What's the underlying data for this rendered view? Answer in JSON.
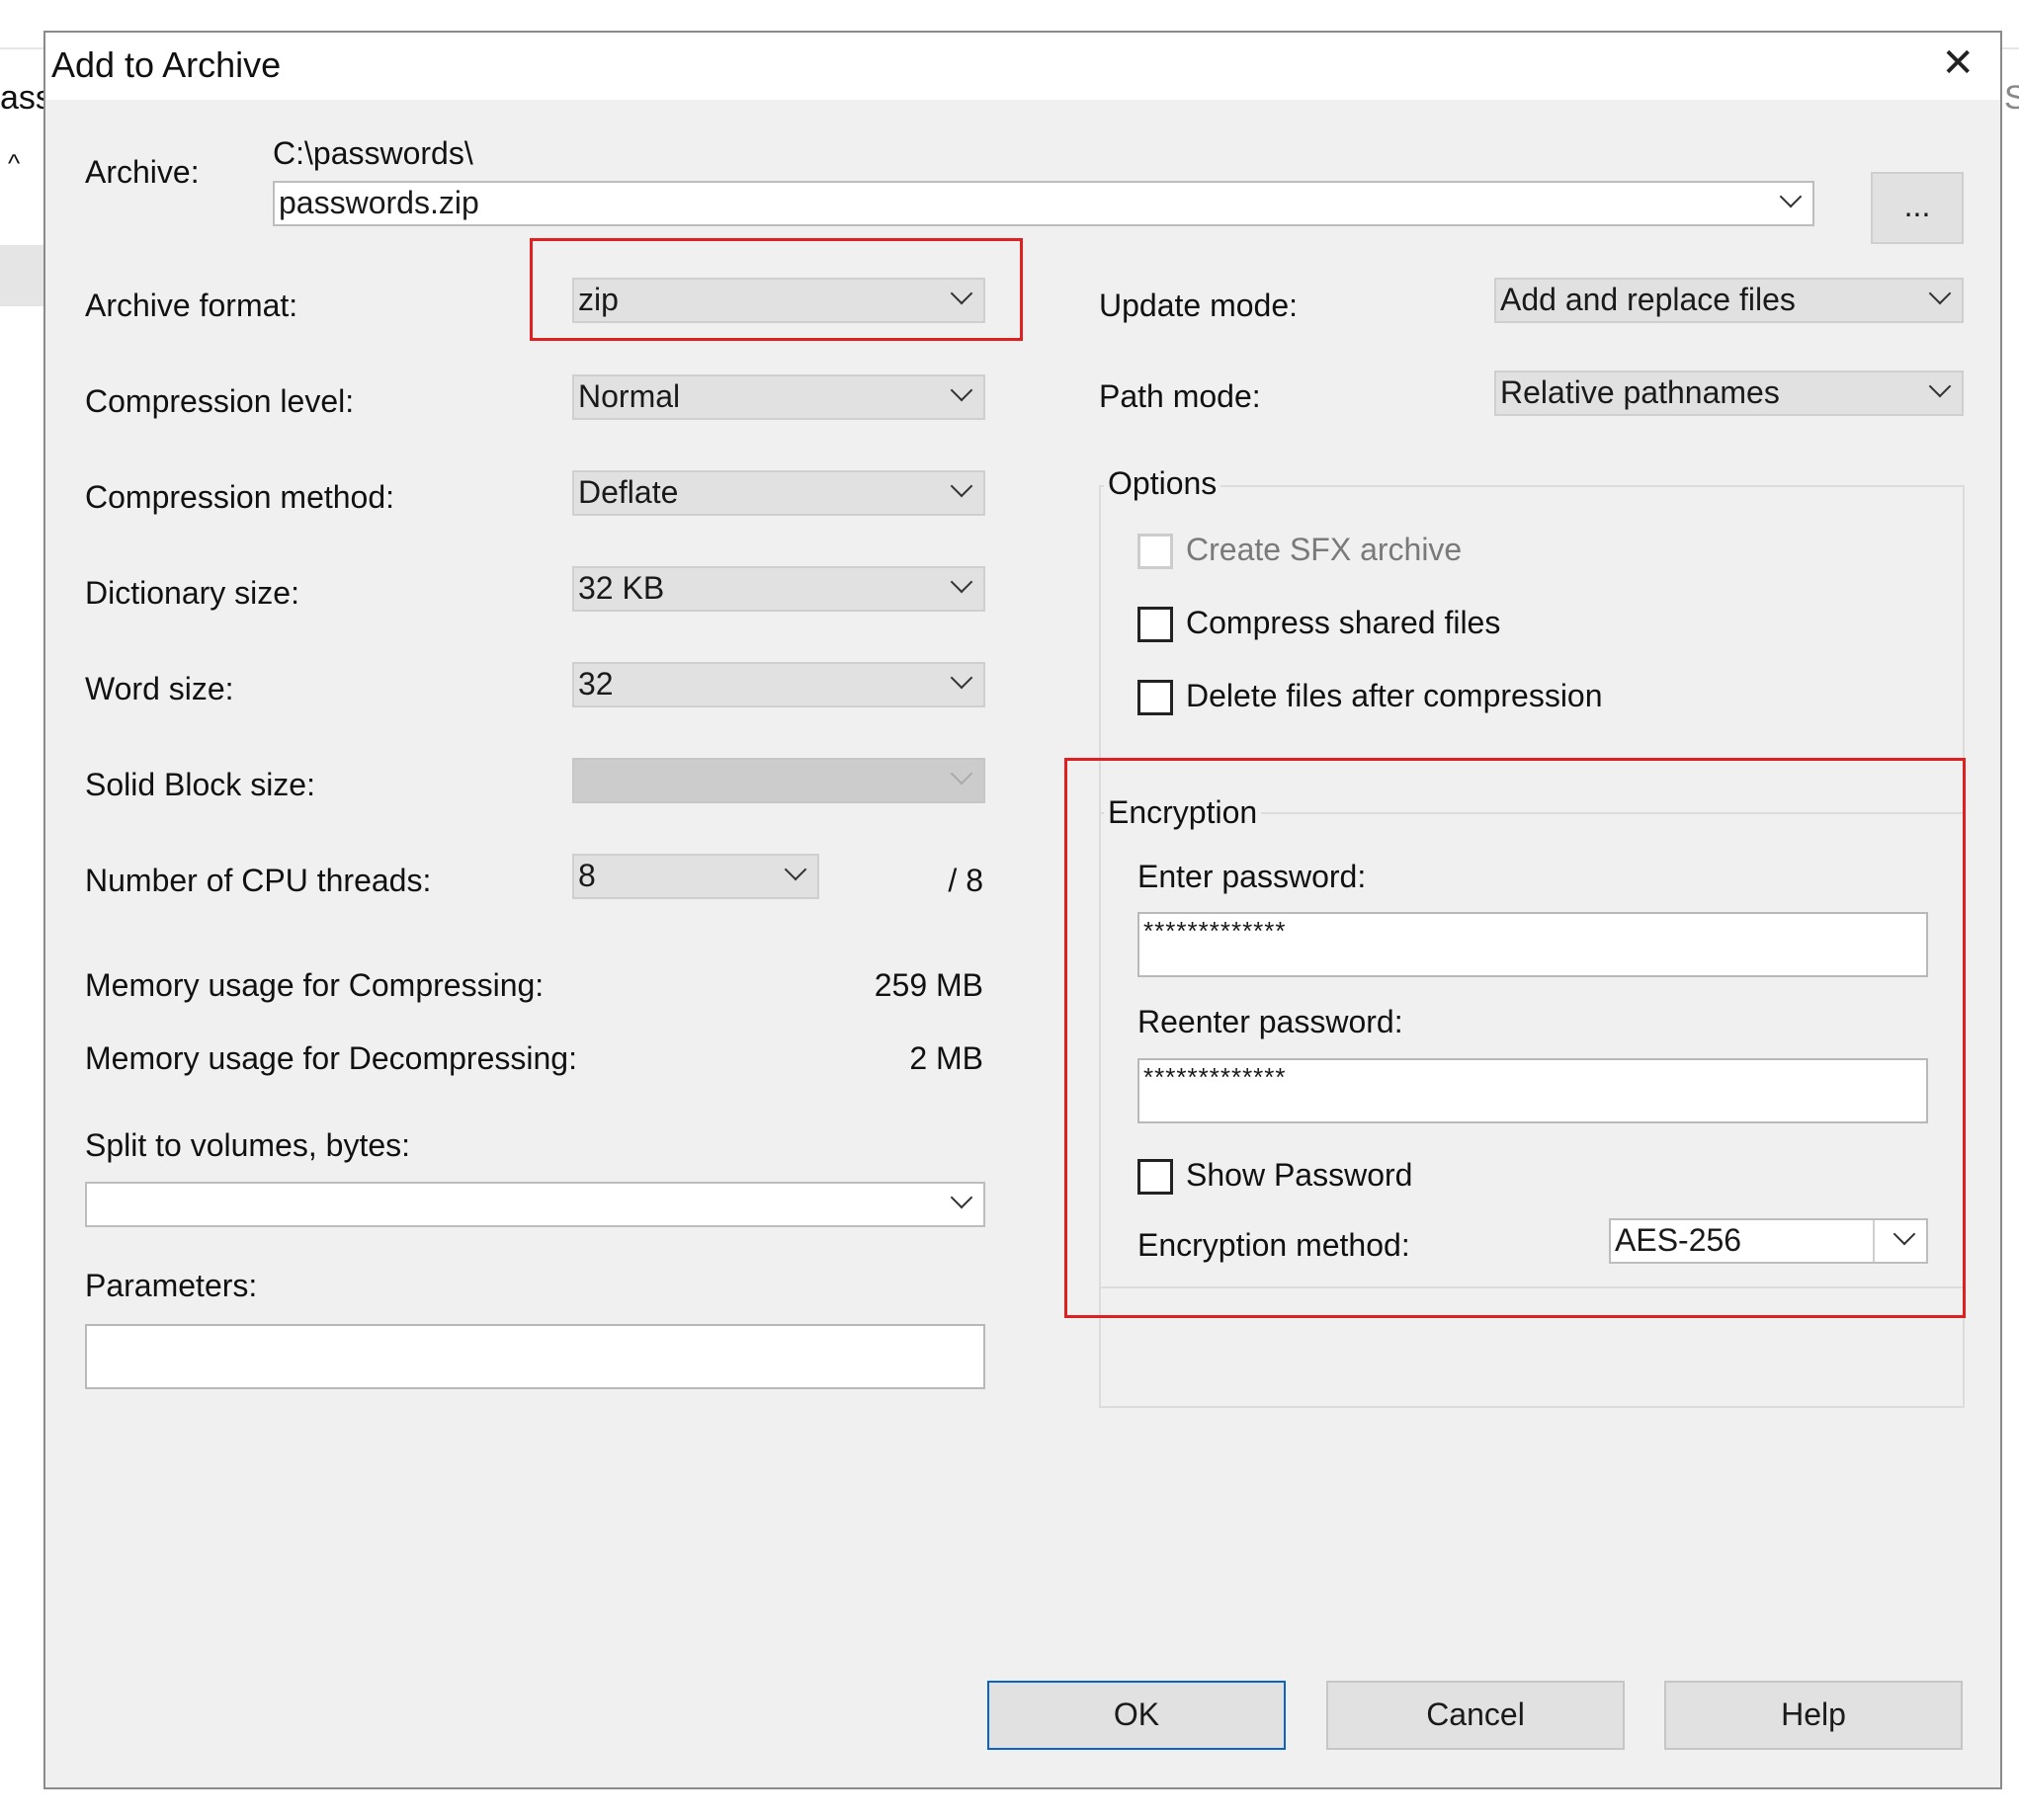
{
  "background": {
    "left_fragment_text": "assv",
    "right_fragment_text": "S",
    "scroll_up_glyph": "^"
  },
  "dialog": {
    "title": "Add to Archive",
    "close_glyph": "✕"
  },
  "archive": {
    "label": "Archive:",
    "path": "C:\\passwords\\",
    "filename": "passwords.zip",
    "browse_label": "..."
  },
  "left": {
    "format_label": "Archive format:",
    "format_value": "zip",
    "level_label": "Compression level:",
    "level_value": "Normal",
    "method_label": "Compression method:",
    "method_value": "Deflate",
    "dict_label": "Dictionary size:",
    "dict_value": "32 KB",
    "word_label": "Word size:",
    "word_value": "32",
    "solid_label": "Solid Block size:",
    "solid_value": "",
    "threads_label": "Number of CPU threads:",
    "threads_value": "8",
    "threads_max": "/ 8",
    "mem_comp_label": "Memory usage for Compressing:",
    "mem_comp_value": "259 MB",
    "mem_decomp_label": "Memory usage for Decompressing:",
    "mem_decomp_value": "2 MB",
    "split_label": "Split to volumes, bytes:",
    "split_value": "",
    "params_label": "Parameters:",
    "params_value": ""
  },
  "right": {
    "update_label": "Update mode:",
    "update_value": "Add and replace files",
    "path_label": "Path mode:",
    "path_value": "Relative pathnames"
  },
  "options": {
    "title": "Options",
    "sfx_label": "Create SFX archive",
    "shared_label": "Compress shared files",
    "delete_label": "Delete files after compression"
  },
  "encryption": {
    "title": "Encryption",
    "enter_label": "Enter password:",
    "enter_value": "*************",
    "reenter_label": "Reenter password:",
    "reenter_value": "*************",
    "show_label": "Show Password",
    "method_label": "Encryption method:",
    "method_value": "AES-256"
  },
  "buttons": {
    "ok": "OK",
    "cancel": "Cancel",
    "help": "Help"
  },
  "colors": {
    "highlight": "#e02020",
    "default_button_border": "#0a64c8",
    "dialog_bg": "#f0f0f0"
  }
}
